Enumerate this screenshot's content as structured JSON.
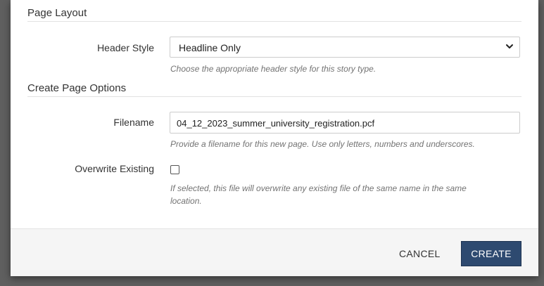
{
  "page_layout": {
    "section_title": "Page Layout",
    "header_style": {
      "label": "Header Style",
      "value": "Headline Only",
      "help": "Choose the appropriate header style for this story type."
    }
  },
  "create_options": {
    "section_title": "Create Page Options",
    "filename": {
      "label": "Filename",
      "value": "04_12_2023_summer_university_registration.pcf",
      "help": "Provide a filename for this new page. Use only letters, numbers and underscores."
    },
    "overwrite": {
      "label": "Overwrite Existing",
      "checked": false,
      "help_line1": "If selected, this file will overwrite any existing file of the same name in the same",
      "help_line2": "location."
    }
  },
  "footer": {
    "cancel_label": "CANCEL",
    "create_label": "CREATE"
  },
  "colors": {
    "primary_button": "#2e4a70",
    "backdrop": "#5f5f5f"
  }
}
